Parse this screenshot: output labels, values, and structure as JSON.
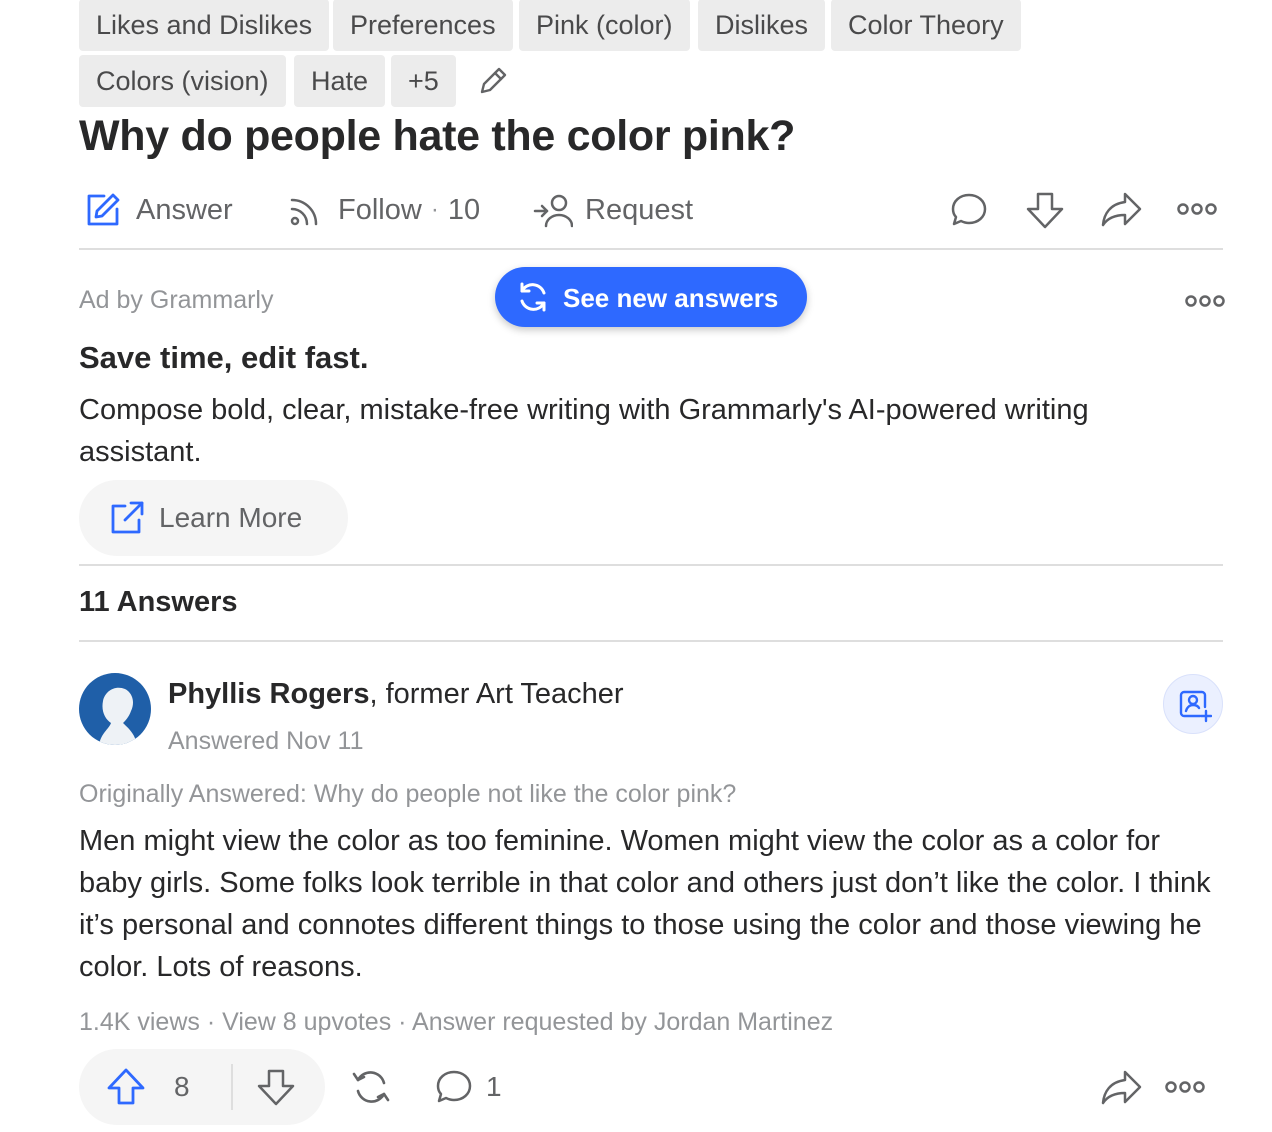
{
  "topics": {
    "row1": [
      "Likes and Dislikes",
      "Preferences",
      "Pink (color)",
      "Dislikes",
      "Color Theory"
    ],
    "row2": [
      "Colors (vision)",
      "Hate",
      "+5"
    ]
  },
  "question": {
    "title": "Why do people hate the color pink?",
    "answer_label": "Answer",
    "follow_label": "Follow",
    "follow_sep": "·",
    "follow_count": "10",
    "request_label": "Request"
  },
  "ad": {
    "sponsor": "Ad by Grammarly",
    "headline": "Save time, edit fast.",
    "body": "Compose bold, clear, mistake-free writing with Grammarly's AI-powered writing assistant.",
    "cta": "Learn More"
  },
  "new_answers_pill": "See new answers",
  "answers_count": "11 Answers",
  "answer": {
    "author": "Phyllis Rogers",
    "credential": ", former Art Teacher",
    "date": "Answered Nov 11",
    "original_question": "Originally Answered: Why do people not like the color pink?",
    "body": "Men might view the color as too feminine. Women might view the color as a color for baby girls. Some folks look terrible in that color and others just don’t like the color. I think it’s personal and connotes different things to those using the color and those viewing he color. Lots of reasons.",
    "stats": {
      "views": "1.4K views",
      "sep": " · ",
      "upvotes_link": "View 8 upvotes",
      "requested": "Answer requested by Jordan Martinez"
    },
    "upvote_count": "8",
    "comment_count": "1"
  },
  "colors": {
    "accent": "#2e69ff",
    "text": "#282829",
    "muted": "#939598",
    "tag_bg": "#ececec",
    "avatar_bg": "#1f5fa8"
  },
  "icons": [
    "pencil-icon",
    "answer-icon",
    "follow-rss-icon",
    "request-icon",
    "comment-icon",
    "downvote-icon",
    "share-icon",
    "more-icon",
    "refresh-icon",
    "external-link-icon",
    "follow-user-icon",
    "upvote-icon",
    "reshare-icon"
  ]
}
